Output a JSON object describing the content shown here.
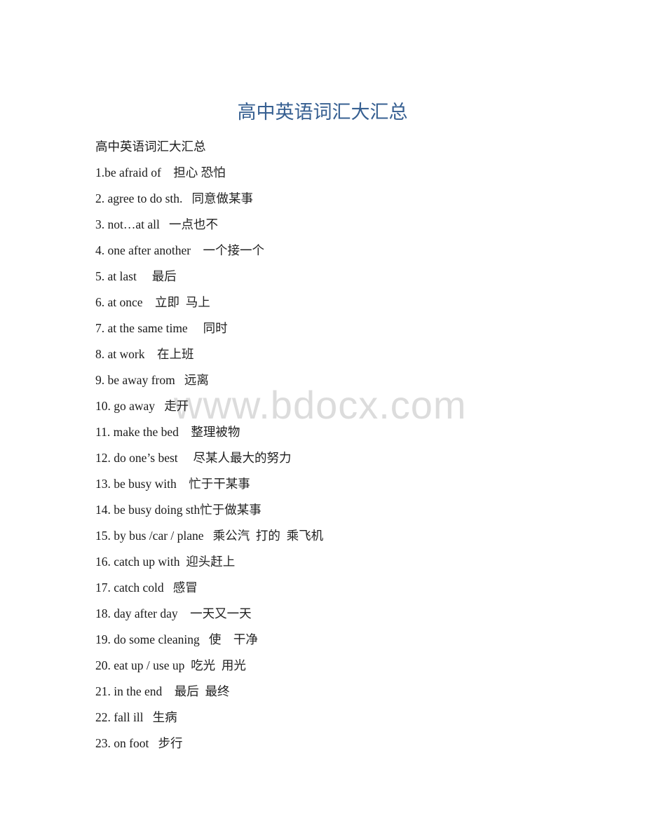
{
  "document": {
    "title": "高中英语词汇大汇总",
    "subtitle": "高中英语词汇大汇总",
    "watermark": "www.bdocx.com",
    "entries": [
      {
        "en": "1.be afraid of    ",
        "cn": "担心 恐怕"
      },
      {
        "en": "2. agree to do sth.   ",
        "cn": "同意做某事"
      },
      {
        "en": "3. not…at all   ",
        "cn": "一点也不"
      },
      {
        "en": "4. one after another    ",
        "cn": "一个接一个"
      },
      {
        "en": "5. at last     ",
        "cn": "最后"
      },
      {
        "en": "6. at once    ",
        "cn": "立即  马上"
      },
      {
        "en": "7. at the same time     ",
        "cn": "同时"
      },
      {
        "en": "8. at work    ",
        "cn": "在上班"
      },
      {
        "en": "9. be away from   ",
        "cn": "远离"
      },
      {
        "en": "10. go away   ",
        "cn": "走开"
      },
      {
        "en": "11. make the bed    ",
        "cn": "整理被物"
      },
      {
        "en": "12. do one’s best     ",
        "cn": "尽某人最大的努力"
      },
      {
        "en": "13. be busy with    ",
        "cn": "忙于干某事"
      },
      {
        "en": "14. be busy doing sth",
        "cn": "忙于做某事"
      },
      {
        "en": "15. by bus /car / plane   ",
        "cn": "乘公汽  打的  乘飞机"
      },
      {
        "en": "16. catch up with  ",
        "cn": "迎头赶上"
      },
      {
        "en": "17. catch cold   ",
        "cn": "感冒"
      },
      {
        "en": "18. day after day    ",
        "cn": "一天又一天"
      },
      {
        "en": "19. do some cleaning   ",
        "cn": "使    干净"
      },
      {
        "en": "20. eat up / use up  ",
        "cn": "吃光  用光"
      },
      {
        "en": "21. in the end    ",
        "cn": "最后  最终"
      },
      {
        "en": "22. fall ill   ",
        "cn": "生病"
      },
      {
        "en": "23. on foot   ",
        "cn": "步行"
      }
    ]
  }
}
